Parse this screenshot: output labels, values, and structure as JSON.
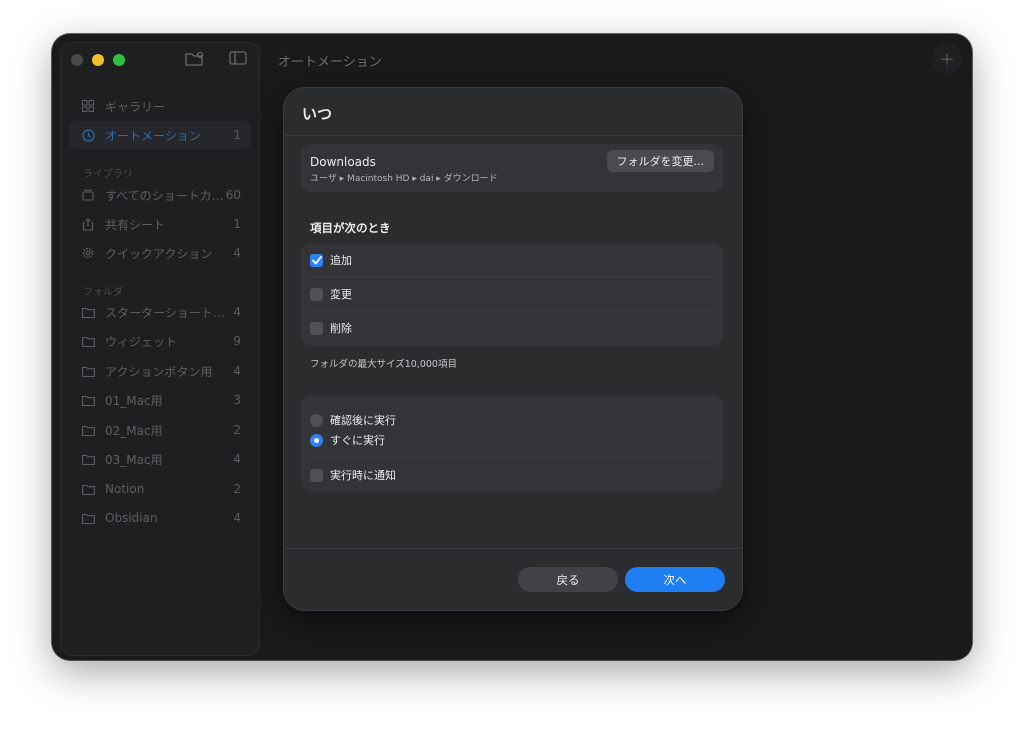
{
  "window": {
    "title": "オートメーション"
  },
  "sidebar": {
    "top_items": [
      {
        "label": "ギャラリー",
        "count": "",
        "icon": "grid-icon"
      },
      {
        "label": "オートメーション",
        "count": "1",
        "icon": "clock-icon"
      }
    ],
    "library_heading": "ライブラリ",
    "library_items": [
      {
        "label": "すべてのショートカ…",
        "count": "60",
        "icon": "stack-icon"
      },
      {
        "label": "共有シート",
        "count": "1",
        "icon": "share-icon"
      },
      {
        "label": "クイックアクション",
        "count": "4",
        "icon": "gear-icon"
      }
    ],
    "folder_heading": "フォルダ",
    "folder_items": [
      {
        "label": "スターターショートカ…",
        "count": "4"
      },
      {
        "label": "ウィジェット",
        "count": "9"
      },
      {
        "label": "アクションボタン用",
        "count": "4"
      },
      {
        "label": "01_Mac用",
        "count": "3"
      },
      {
        "label": "02_Mac用",
        "count": "2"
      },
      {
        "label": "03_Mac用",
        "count": "4"
      },
      {
        "label": "Notion",
        "count": "2"
      },
      {
        "label": "Obsidian",
        "count": "4"
      }
    ]
  },
  "dialog": {
    "title": "いつ",
    "folder": {
      "name": "Downloads",
      "path": "ユーザ ▸ Macintosh HD ▸ dai ▸ ダウンロード",
      "change_button": "フォルダを変更..."
    },
    "when_heading": "項目が次のとき",
    "conditions": [
      {
        "label": "追加",
        "checked": true
      },
      {
        "label": "変更",
        "checked": false
      },
      {
        "label": "削除",
        "checked": false
      }
    ],
    "max_size_note": "フォルダの最大サイズ10,000項目",
    "run_options": [
      {
        "label": "確認後に実行",
        "selected": false
      },
      {
        "label": "すぐに実行",
        "selected": true
      }
    ],
    "notify": {
      "label": "実行時に通知",
      "checked": false
    },
    "back_button": "戻る",
    "next_button": "次へ"
  },
  "colors": {
    "accent": "#1e7ef2",
    "checkbox_on": "#2f82f6"
  }
}
